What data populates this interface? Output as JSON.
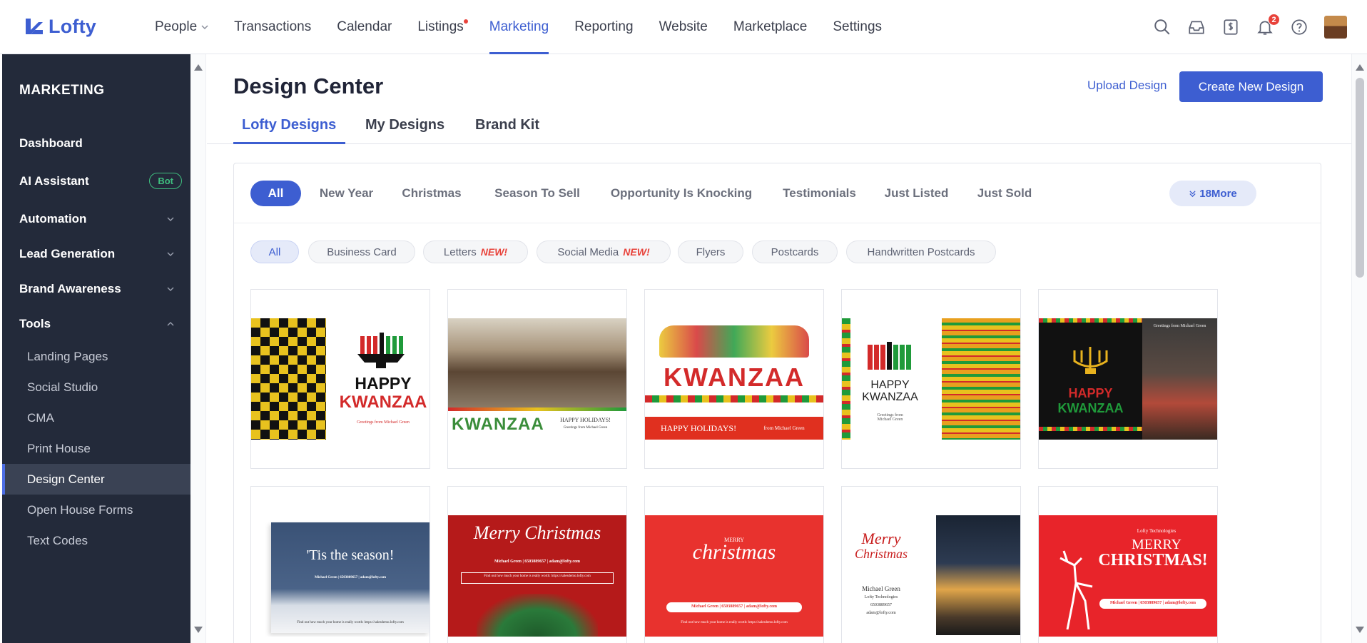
{
  "app": {
    "logo": "Lofty"
  },
  "nav": [
    {
      "label": "People",
      "has_dropdown": true
    },
    {
      "label": "Transactions"
    },
    {
      "label": "Calendar"
    },
    {
      "label": "Listings",
      "has_dot": true
    },
    {
      "label": "Marketing",
      "active": true
    },
    {
      "label": "Reporting"
    },
    {
      "label": "Website"
    },
    {
      "label": "Marketplace"
    },
    {
      "label": "Settings"
    }
  ],
  "top_icons": {
    "notifications_count": "2"
  },
  "sidebar": {
    "title": "MARKETING",
    "items": [
      {
        "label": "Dashboard"
      },
      {
        "label": "AI Assistant",
        "badge": "Bot"
      },
      {
        "label": "Automation"
      },
      {
        "label": "Lead Generation"
      },
      {
        "label": "Brand Awareness"
      },
      {
        "label": "Tools"
      }
    ],
    "tools": [
      {
        "label": "Landing Pages"
      },
      {
        "label": "Social Studio"
      },
      {
        "label": "CMA"
      },
      {
        "label": "Print House"
      },
      {
        "label": "Design Center",
        "active": true
      },
      {
        "label": "Open House Forms"
      },
      {
        "label": "Text Codes"
      }
    ]
  },
  "header": {
    "title": "Design Center",
    "upload_label": "Upload Design",
    "create_label": "Create New Design"
  },
  "tabs": [
    {
      "label": "Lofty Designs",
      "active": true
    },
    {
      "label": "My Designs"
    },
    {
      "label": "Brand Kit"
    }
  ],
  "categories": [
    "All",
    "New Year",
    "Christmas",
    "Season To Sell",
    "Opportunity Is Knocking",
    "Testimonials",
    "Just Listed",
    "Just Sold"
  ],
  "more_label": "18More",
  "types": [
    {
      "label": "All"
    },
    {
      "label": "Business Card"
    },
    {
      "label": "Letters",
      "new": "NEW!"
    },
    {
      "label": "Social Media",
      "new": "NEW!"
    },
    {
      "label": "Flyers"
    },
    {
      "label": "Postcards"
    },
    {
      "label": "Handwritten Postcards"
    }
  ],
  "cards": {
    "c1": {
      "title1": "HAPPY",
      "title2": "KWANZAA",
      "greet": "Greetings from Michael Green"
    },
    "c2": {
      "title": "KWANZAA",
      "greet": "HAPPY HOLIDAYS!",
      "sub": "Greetings from Michael Green"
    },
    "c3": {
      "title": "KWANZAA",
      "banner": "HAPPY HOLIDAYS!",
      "from": "from Michael Green"
    },
    "c4": {
      "title1": "HAPPY",
      "title2": "KWANZAA",
      "greet": "Greetings from Michael Green"
    },
    "c5": {
      "title1": "HAPPY",
      "title2": "KWANZAA",
      "greet": "Greetings from Michael Green"
    },
    "c6": {
      "title": "'Tis the season!",
      "line": "Michael Green | 6503889657 | adam@lofty.com",
      "foot": "Find out how much your home is really worth: https://salesdemo.lofty.com"
    },
    "c7": {
      "title": "Merry Christmas",
      "line": "Michael Green | 6503889657 | adam@lofty.com",
      "foot": "Find out how much your home is really worth: https://salesdemo.lofty.com"
    },
    "c8": {
      "small": "MERRY",
      "title": "christmas",
      "line": "Michael Green | 6503889657 | adam@lofty.com",
      "foot": "Find out how much your home is really worth: https://salesdemo.lofty.com"
    },
    "c9": {
      "title1": "Merry",
      "title2": "Christmas",
      "name": "Michael Green",
      "co": "Lofty Technologies",
      "phone": "6503889657",
      "mail": "adam@lofty.com"
    },
    "c10": {
      "co": "Lofty Technologies",
      "title1": "MERRY",
      "title2": "CHRISTMAS!",
      "line": "Michael Green | 6503889657 | adam@lofty.com"
    }
  },
  "colors": {
    "accent": "#3d5ed1",
    "sidebar_bg": "#232a3a",
    "new_tag": "#e8423a"
  }
}
